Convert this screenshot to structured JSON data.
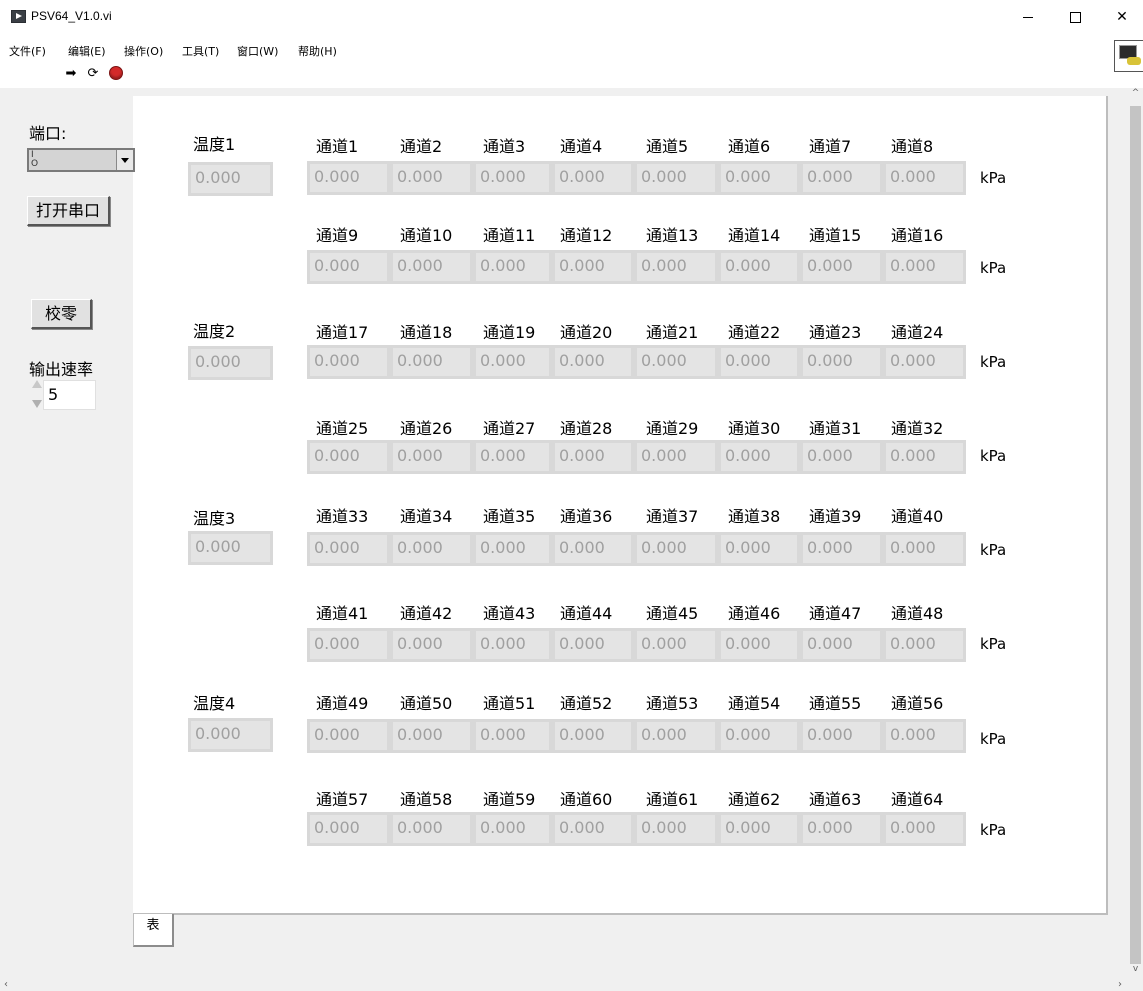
{
  "window": {
    "title": "PSV64_V1.0.vi",
    "minimize": "–",
    "maximize": "□",
    "close": "✕"
  },
  "menu": [
    "文件(F)",
    "编辑(E)",
    "操作(O)",
    "工具(T)",
    "窗口(W)",
    "帮助(H)"
  ],
  "toolbar": {
    "run_icon": "run-arrow-icon",
    "continuous_icon": "run-continuously-icon",
    "abort_icon": "abort-icon"
  },
  "controls": {
    "port_label": "端口:",
    "port_value": "",
    "open_serial_button": "打开串口",
    "zero_button": "校零",
    "rate_label": "输出速率",
    "rate_value": "5"
  },
  "temperatures": [
    {
      "label": "温度1",
      "value": "0.000"
    },
    {
      "label": "温度2",
      "value": "0.000"
    },
    {
      "label": "温度3",
      "value": "0.000"
    },
    {
      "label": "温度4",
      "value": "0.000"
    }
  ],
  "unit": "kPa",
  "channels": [
    {
      "label": "通道1",
      "value": "0.000"
    },
    {
      "label": "通道2",
      "value": "0.000"
    },
    {
      "label": "通道3",
      "value": "0.000"
    },
    {
      "label": "通道4",
      "value": "0.000"
    },
    {
      "label": "通道5",
      "value": "0.000"
    },
    {
      "label": "通道6",
      "value": "0.000"
    },
    {
      "label": "通道7",
      "value": "0.000"
    },
    {
      "label": "通道8",
      "value": "0.000"
    },
    {
      "label": "通道9",
      "value": "0.000"
    },
    {
      "label": "通道10",
      "value": "0.000"
    },
    {
      "label": "通道11",
      "value": "0.000"
    },
    {
      "label": "通道12",
      "value": "0.000"
    },
    {
      "label": "通道13",
      "value": "0.000"
    },
    {
      "label": "通道14",
      "value": "0.000"
    },
    {
      "label": "通道15",
      "value": "0.000"
    },
    {
      "label": "通道16",
      "value": "0.000"
    },
    {
      "label": "通道17",
      "value": "0.000"
    },
    {
      "label": "通道18",
      "value": "0.000"
    },
    {
      "label": "通道19",
      "value": "0.000"
    },
    {
      "label": "通道20",
      "value": "0.000"
    },
    {
      "label": "通道21",
      "value": "0.000"
    },
    {
      "label": "通道22",
      "value": "0.000"
    },
    {
      "label": "通道23",
      "value": "0.000"
    },
    {
      "label": "通道24",
      "value": "0.000"
    },
    {
      "label": "通道25",
      "value": "0.000"
    },
    {
      "label": "通道26",
      "value": "0.000"
    },
    {
      "label": "通道27",
      "value": "0.000"
    },
    {
      "label": "通道28",
      "value": "0.000"
    },
    {
      "label": "通道29",
      "value": "0.000"
    },
    {
      "label": "通道30",
      "value": "0.000"
    },
    {
      "label": "通道31",
      "value": "0.000"
    },
    {
      "label": "通道32",
      "value": "0.000"
    },
    {
      "label": "通道33",
      "value": "0.000"
    },
    {
      "label": "通道34",
      "value": "0.000"
    },
    {
      "label": "通道35",
      "value": "0.000"
    },
    {
      "label": "通道36",
      "value": "0.000"
    },
    {
      "label": "通道37",
      "value": "0.000"
    },
    {
      "label": "通道38",
      "value": "0.000"
    },
    {
      "label": "通道39",
      "value": "0.000"
    },
    {
      "label": "通道40",
      "value": "0.000"
    },
    {
      "label": "通道41",
      "value": "0.000"
    },
    {
      "label": "通道42",
      "value": "0.000"
    },
    {
      "label": "通道43",
      "value": "0.000"
    },
    {
      "label": "通道44",
      "value": "0.000"
    },
    {
      "label": "通道45",
      "value": "0.000"
    },
    {
      "label": "通道46",
      "value": "0.000"
    },
    {
      "label": "通道47",
      "value": "0.000"
    },
    {
      "label": "通道48",
      "value": "0.000"
    },
    {
      "label": "通道49",
      "value": "0.000"
    },
    {
      "label": "通道50",
      "value": "0.000"
    },
    {
      "label": "通道51",
      "value": "0.000"
    },
    {
      "label": "通道52",
      "value": "0.000"
    },
    {
      "label": "通道53",
      "value": "0.000"
    },
    {
      "label": "通道54",
      "value": "0.000"
    },
    {
      "label": "通道55",
      "value": "0.000"
    },
    {
      "label": "通道56",
      "value": "0.000"
    },
    {
      "label": "通道57",
      "value": "0.000"
    },
    {
      "label": "通道58",
      "value": "0.000"
    },
    {
      "label": "通道59",
      "value": "0.000"
    },
    {
      "label": "通道60",
      "value": "0.000"
    },
    {
      "label": "通道61",
      "value": "0.000"
    },
    {
      "label": "通道62",
      "value": "0.000"
    },
    {
      "label": "通道63",
      "value": "0.000"
    },
    {
      "label": "通道64",
      "value": "0.000"
    }
  ],
  "tab": {
    "label": "表"
  },
  "colors": {
    "indicator_bg": "#e4e4e4",
    "indicator_text": "#a0a0a0",
    "abort_red": "#d32a2a"
  }
}
